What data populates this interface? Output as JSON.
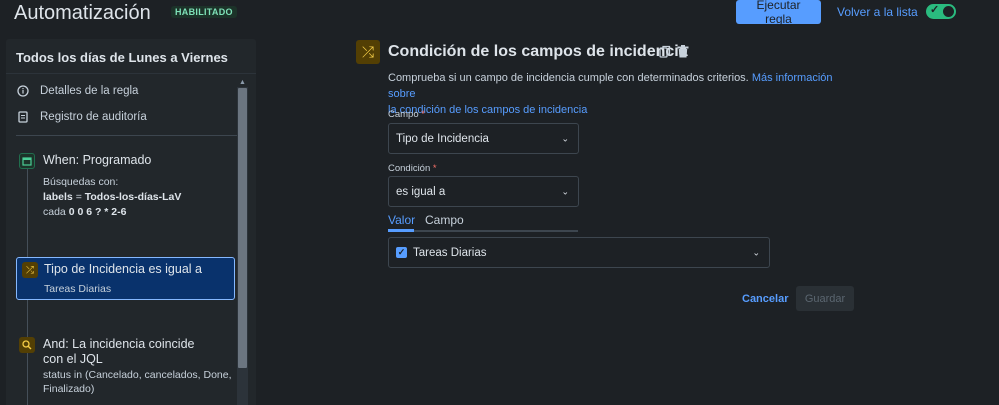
{
  "header": {
    "title": "Automatización",
    "status_badge": "HABILITADO",
    "run_button": "Ejecutar regla",
    "back_link": "Volver a la lista",
    "toggle_on": true
  },
  "sidebar": {
    "title": "Todos los días de Lunes a Viernes",
    "links": [
      {
        "label": "Detalles de la regla",
        "icon": "info-icon"
      },
      {
        "label": "Registro de auditoría",
        "icon": "document-icon"
      }
    ],
    "trigger": {
      "icon": "calendar-icon",
      "title": "When: Programado",
      "line1": "Búsquedas con:",
      "line2_key": "labels",
      "line2_op": " = ",
      "line2_val": "Todos-los-días-LaV",
      "line3_prefix": "cada ",
      "line3_val": "0 0 6 ? * 2-6"
    },
    "selected_condition": {
      "icon": "shuffle-icon",
      "title": "Tipo de Incidencia es igual a",
      "value": "Tareas Diarias"
    },
    "jql_condition": {
      "icon": "search-icon",
      "title_line1": "And: La incidencia coincide",
      "title_line2": "con el JQL",
      "line1": "status in (Cancelado, cancelados, Done,",
      "line2": "Finalizado)"
    }
  },
  "panel": {
    "icon": "shuffle-icon",
    "title": "Condición de los campos de incidencia",
    "description": "Comprueba si un campo de incidencia cumple con determinados criterios.",
    "link_line1": "Más información sobre",
    "link_line2": "la condición de los campos de incidencia",
    "field_label": "Campo",
    "field_value": "Tipo de Incidencia",
    "condition_label": "Condición",
    "condition_value": "es igual a",
    "required_mark": "*",
    "tabs": [
      "Valor",
      "Campo"
    ],
    "active_tab": "Valor",
    "value_selected": "Tareas Diarias",
    "cancel": "Cancelar",
    "save": "Guardar"
  },
  "colors": {
    "background": "#1d2125",
    "accent": "#579dff",
    "success": "#2abb7f",
    "condition_icon": "#533f04",
    "trigger_icon": "#4bce97"
  }
}
